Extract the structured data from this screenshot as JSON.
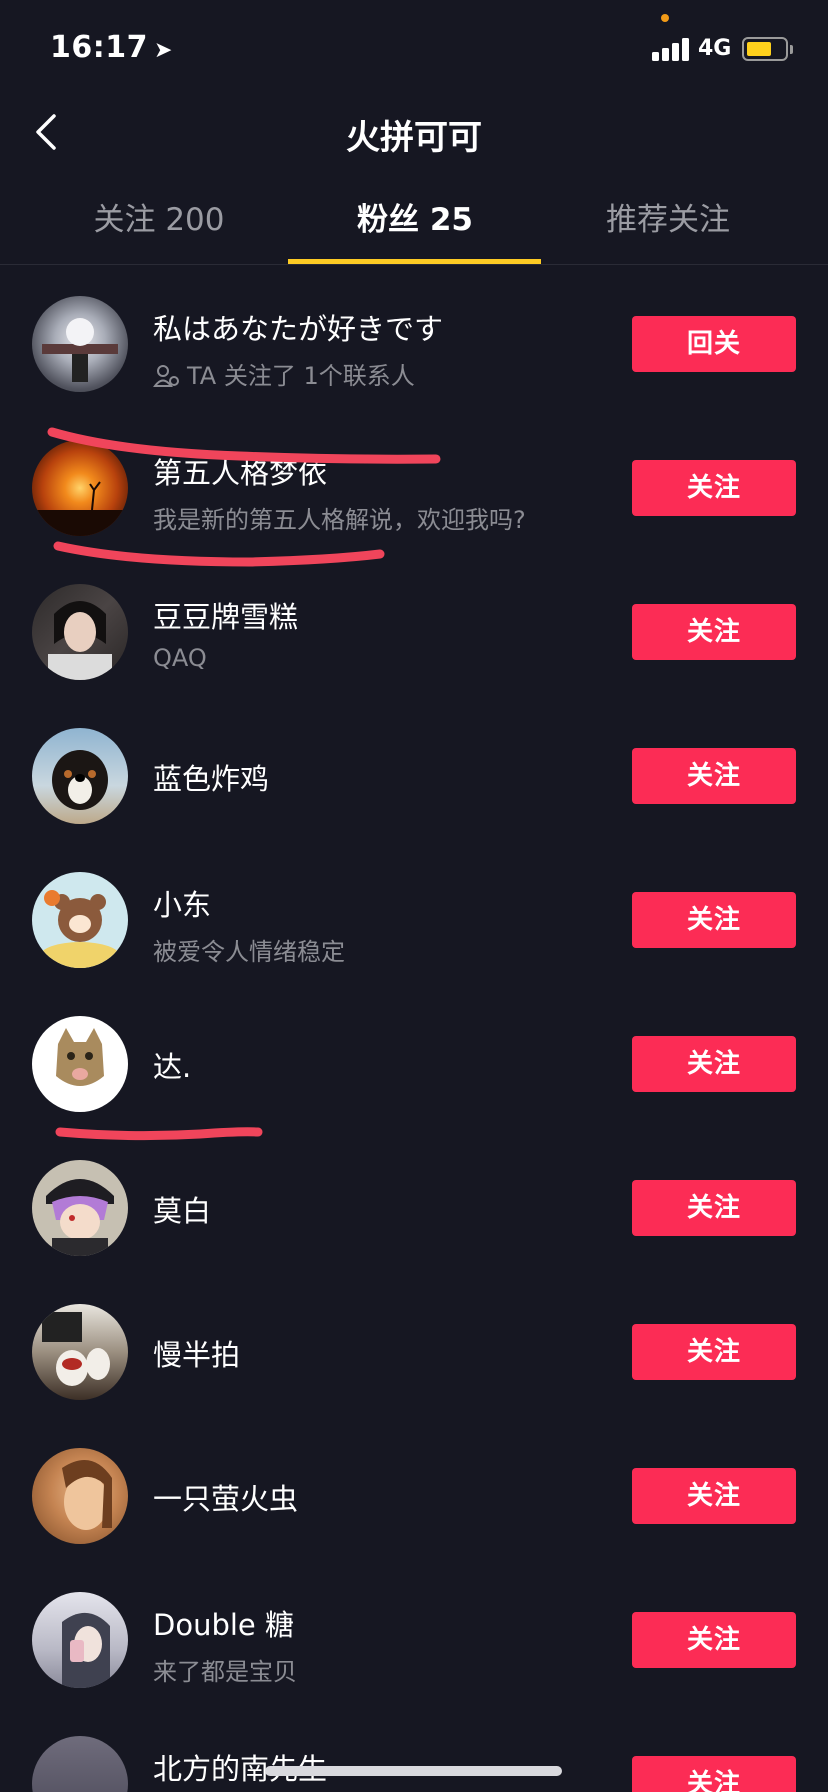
{
  "status": {
    "time": "16:17",
    "location_icon": "location-arrow-icon",
    "network": "4G",
    "battery_color": "#fed01c"
  },
  "nav": {
    "back_icon": "chevron-left-icon",
    "title": "火拼可可"
  },
  "tabs": [
    {
      "label": "关注 200",
      "active": false
    },
    {
      "label": "粉丝 25",
      "active": true
    },
    {
      "label": "推荐关注",
      "active": false
    }
  ],
  "colors": {
    "background": "#161722",
    "follow_button": "#fc2c55",
    "tab_indicator": "#fdcb24",
    "annotation_stroke": "#f0455b"
  },
  "followers": [
    {
      "name": "私はあなたが好きです",
      "subtitle": "TA 关注了 1个联系人",
      "subtitle_icon": "contacts-icon",
      "button": "回关"
    },
    {
      "name": "第五人格梦依",
      "subtitle": "我是新的第五人格解说，欢迎我吗?",
      "button": "关注"
    },
    {
      "name": "豆豆牌雪糕",
      "subtitle": "QAQ",
      "button": "关注"
    },
    {
      "name": "蓝色炸鸡",
      "subtitle": "",
      "button": "关注"
    },
    {
      "name": "小东",
      "subtitle": "被爱令人情绪稳定",
      "button": "关注"
    },
    {
      "name": "达.",
      "subtitle": "",
      "button": "关注"
    },
    {
      "name": "莫白",
      "subtitle": "",
      "button": "关注"
    },
    {
      "name": "慢半拍",
      "subtitle": "",
      "button": "关注"
    },
    {
      "name": "一只萤火虫",
      "subtitle": "",
      "button": "关注"
    },
    {
      "name": "Double 糖",
      "subtitle": "来了都是宝贝",
      "button": "关注"
    },
    {
      "name": "北方的南先生",
      "subtitle": "",
      "button": "关注"
    }
  ]
}
